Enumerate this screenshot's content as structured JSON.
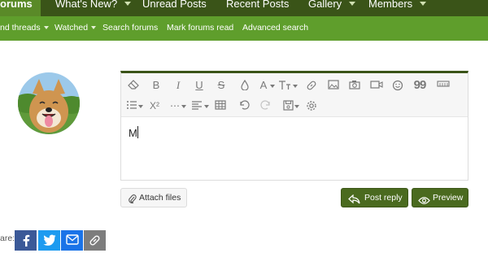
{
  "top_nav": {
    "tabs": [
      {
        "label": "orums",
        "active": true,
        "has_caret": false
      },
      {
        "label": "What's New?",
        "active": false,
        "has_caret": true
      },
      {
        "label": "Unread Posts",
        "active": false,
        "has_caret": false
      },
      {
        "label": "Recent Posts",
        "active": false,
        "has_caret": false
      },
      {
        "label": "Gallery",
        "active": false,
        "has_caret": true
      },
      {
        "label": "Members",
        "active": false,
        "has_caret": true
      }
    ]
  },
  "sub_nav": {
    "links": [
      {
        "label": "nd threads",
        "has_caret": true
      },
      {
        "label": "Watched",
        "has_caret": true
      },
      {
        "label": "Search forums",
        "has_caret": false
      },
      {
        "label": "Mark forums read",
        "has_caret": false
      },
      {
        "label": "Advanced search",
        "has_caret": false
      }
    ]
  },
  "editor": {
    "typed_text": "M",
    "toolbar_row1": [
      "eraser-icon",
      "bold-icon",
      "italic-icon",
      "underline-icon",
      "strikethrough-icon",
      "text-color-icon",
      "font-family-icon",
      "font-size-icon",
      "link-icon",
      "image-icon",
      "camera-icon",
      "video-icon",
      "smilie-icon",
      "quote-icon",
      "horizontal-rule-icon"
    ],
    "toolbar_row2": [
      "list-icon",
      "superscript-icon",
      "more-options-icon",
      "align-icon",
      "table-icon",
      "undo-icon",
      "redo-icon",
      "drafts-icon",
      "settings-icon"
    ],
    "glyphs": {
      "bold": "B",
      "italic": "I",
      "underline": "U",
      "strike": "S",
      "font": "A",
      "superscript": "X²",
      "quote": "99"
    }
  },
  "actions": {
    "attach_label": "Attach files",
    "post_reply_label": "Post reply",
    "preview_label": "Preview"
  },
  "share": {
    "label": "are:",
    "buttons": [
      "facebook-icon",
      "twitter-icon",
      "email-icon",
      "link-icon"
    ]
  },
  "colors": {
    "top_nav": "#3a5418",
    "sub_nav": "#5f9e2c",
    "primary_button": "#4a6a1f",
    "facebook": "#3b5998",
    "twitter": "#1d9bf0",
    "email": "#1a73e8",
    "copy_link": "#7d7d7d"
  }
}
